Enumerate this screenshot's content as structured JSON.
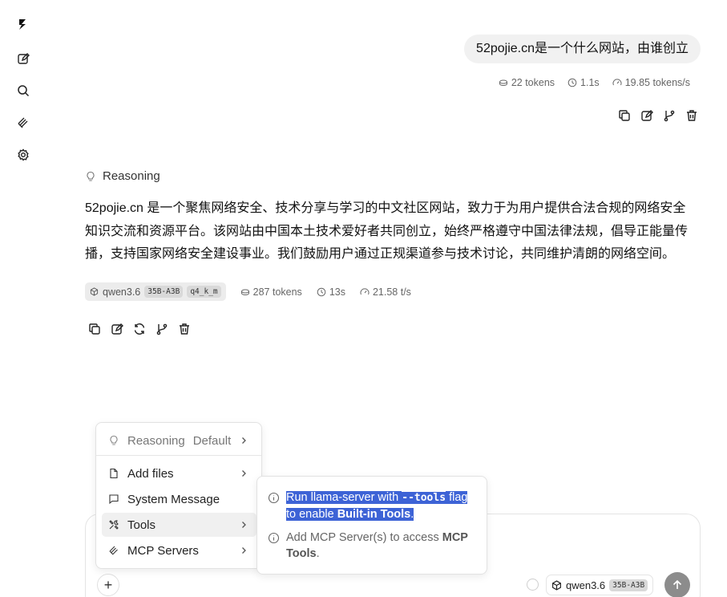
{
  "sidebar": {
    "items": [
      {
        "icon": "logo-icon"
      },
      {
        "icon": "new-chat-icon"
      },
      {
        "icon": "search-icon"
      },
      {
        "icon": "tools-icon"
      },
      {
        "icon": "settings-icon"
      }
    ]
  },
  "user_message": {
    "text": "52pojie.cn是一个什么网站，由谁创立",
    "tokens": "22 tokens",
    "time": "1.1s",
    "speed": "19.85 tokens/s"
  },
  "assistant_message": {
    "reasoning_label": "Reasoning",
    "text": "52pojie.cn 是一个聚焦网络安全、技术分享与学习的中文社区网站，致力于为用户提供合法合规的网络安全知识交流和资源平台。该网站由中国本土技术爱好者共同创立，始终严格遵守中国法律法规，倡导正能量传播，支持国家网络安全建设事业。我们鼓励用户通过正规渠道参与技术讨论，共同维护清朗的网络空间。",
    "model": "qwen3.6",
    "model_tag": "35B-A3B",
    "quant_tag": "q4_k_m",
    "tokens": "287 tokens",
    "time": "13s",
    "speed": "21.58 t/s"
  },
  "menu": {
    "reasoning_label": "Reasoning",
    "reasoning_value": "Default",
    "add_files": "Add files",
    "system_message": "System Message",
    "tools": "Tools",
    "mcp_servers": "MCP Servers"
  },
  "tools_popover": {
    "tip1_pre": "Run llama-server with ",
    "tip1_code": "--tools",
    "tip1_mid": " flag to enable ",
    "tip1_bold": "Built-in Tools",
    "tip1_end": ".",
    "tip2_pre": "Add MCP Server(s) to access ",
    "tip2_bold": "MCP Tools",
    "tip2_end": "."
  },
  "composer": {
    "plus": "+",
    "model": "qwen3.6",
    "model_tag": "35B-A3B"
  }
}
